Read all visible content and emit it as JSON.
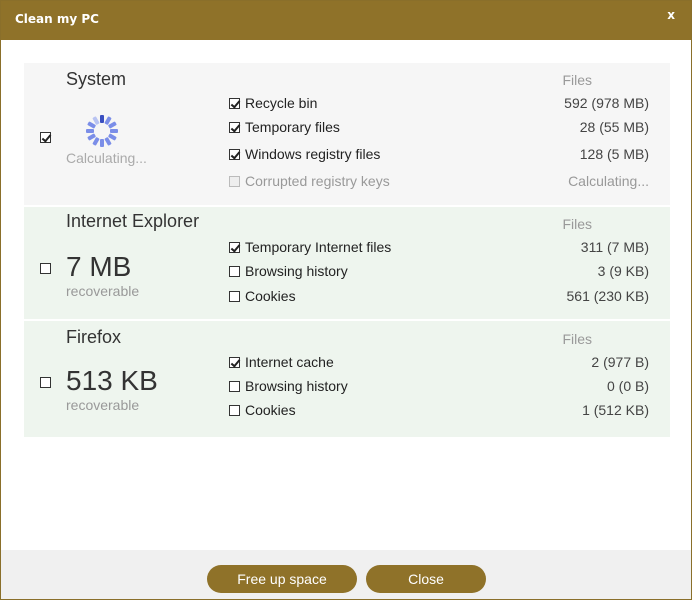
{
  "window": {
    "title": "Clean my PC",
    "close_label": "x"
  },
  "files_header": "Files",
  "sections": {
    "system": {
      "title": "System",
      "checked": true,
      "status": "Calculating...",
      "items": [
        {
          "label": "Recycle bin",
          "value": "592 (978 MB)",
          "checked": true
        },
        {
          "label": "Temporary files",
          "value": "28 (55 MB)",
          "checked": true
        },
        {
          "label": "Windows registry files",
          "value": "128 (5 MB)",
          "checked": true
        },
        {
          "label": "Corrupted registry keys",
          "value": "Calculating...",
          "checked": false,
          "disabled": true
        }
      ]
    },
    "ie": {
      "title": "Internet Explorer",
      "checked": false,
      "size": "7 MB",
      "sublabel": "recoverable",
      "items": [
        {
          "label": "Temporary Internet files",
          "value": "311 (7 MB)",
          "checked": true
        },
        {
          "label": "Browsing history",
          "value": "3 (9 KB)",
          "checked": false
        },
        {
          "label": "Cookies",
          "value": "561 (230 KB)",
          "checked": false
        }
      ]
    },
    "firefox": {
      "title": "Firefox",
      "checked": false,
      "size": "513 KB",
      "sublabel": "recoverable",
      "items": [
        {
          "label": "Internet cache",
          "value": "2 (977 B)",
          "checked": true
        },
        {
          "label": "Browsing history",
          "value": "0 (0 B)",
          "checked": false
        },
        {
          "label": "Cookies",
          "value": "1 (512 KB)",
          "checked": false
        }
      ]
    }
  },
  "footer": {
    "free_label": "Free up space",
    "close_label": "Close"
  },
  "colors": {
    "accent": "#8f7229",
    "section_green": "#eef5ee",
    "section_gray": "#f6f6f6",
    "spinner": "#7b8ee8"
  }
}
